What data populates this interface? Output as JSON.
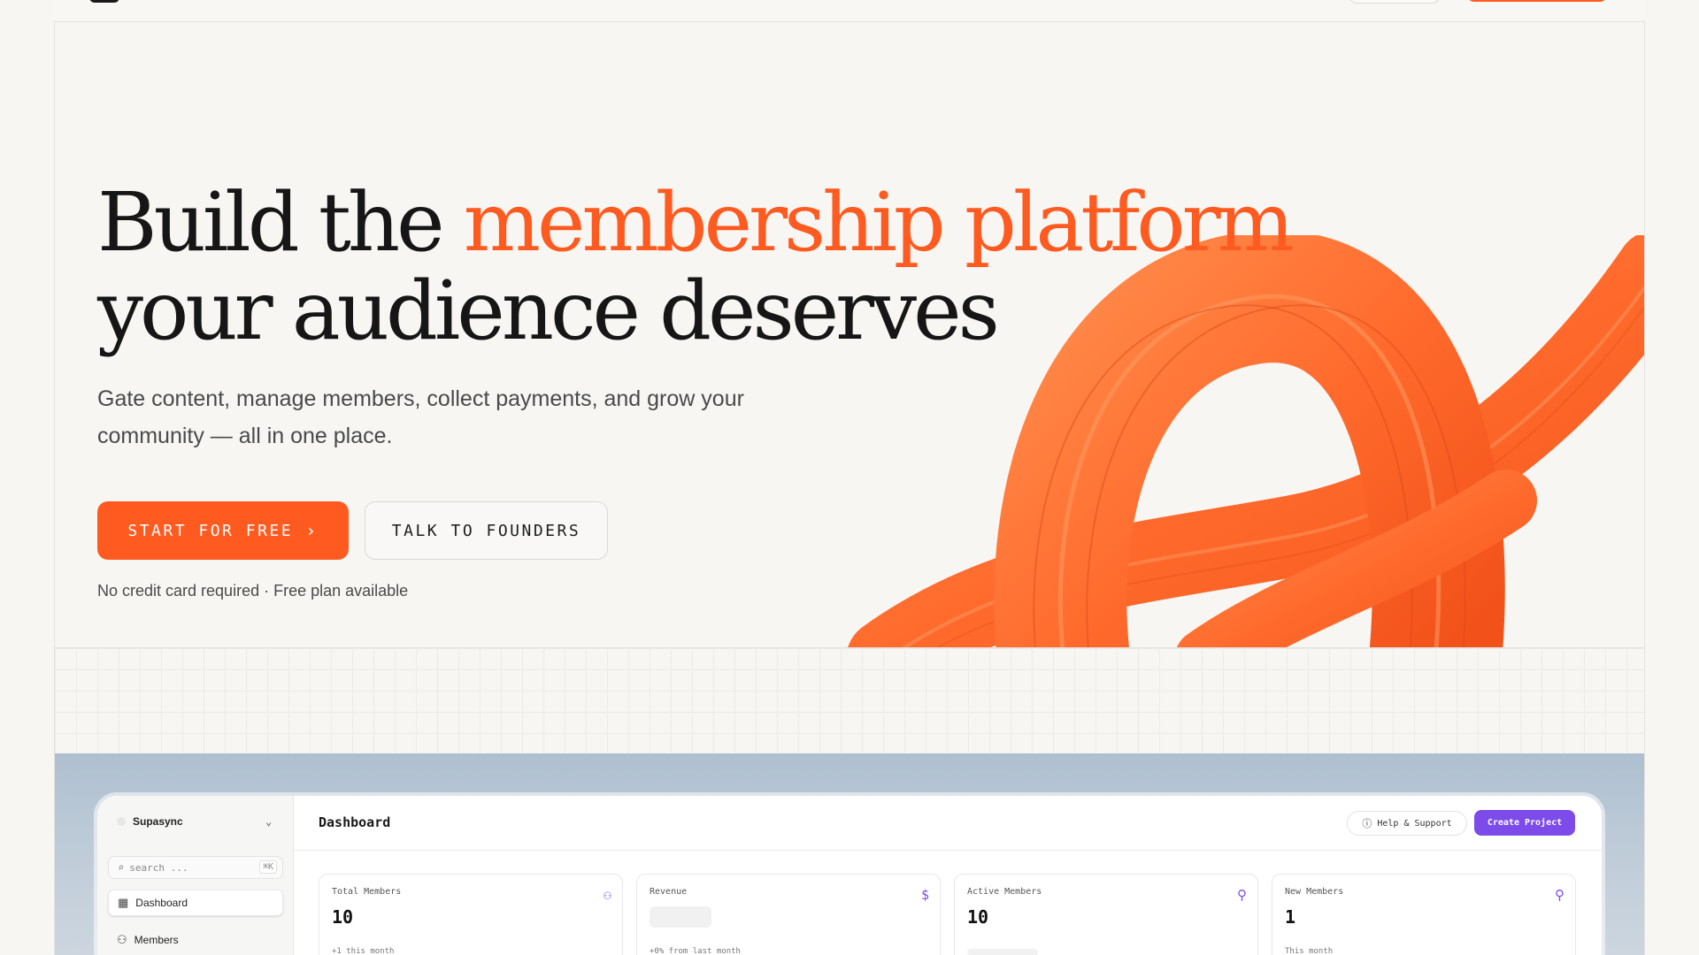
{
  "hero": {
    "headline_part1": "Build the ",
    "headline_accent": "membership platform",
    "headline_line2": "your audience deserves",
    "subheadline": "Gate content, manage members, collect payments, and grow your community — all in one place.",
    "primary_cta": "START FOR FREE",
    "secondary_cta": "TALK TO FOUNDERS",
    "note": "No credit card required · Free plan available"
  },
  "colors": {
    "accent": "#ff5a1f",
    "app_accent": "#7c4bea",
    "background": "#f7f6f3"
  },
  "app": {
    "workspace_name": "Supasync",
    "search_placeholder": "search ...",
    "search_shortcut": "⌘K",
    "sidebar": {
      "items": [
        {
          "label": "Dashboard",
          "icon": "grid-icon",
          "active": true
        },
        {
          "label": "Members",
          "icon": "users-icon",
          "active": false
        }
      ]
    },
    "header": {
      "title": "Dashboard",
      "help_label": "Help & Support",
      "create_label": "Create Project"
    },
    "stats": [
      {
        "label": "Total Members",
        "value": "10",
        "sub": "+1 this month",
        "icon": "users-icon"
      },
      {
        "label": "Revenue",
        "value": "",
        "sub": "+0% from last month",
        "icon": "dollar-icon"
      },
      {
        "label": "Active Members",
        "value": "10",
        "sub": "",
        "icon": "user-check-icon"
      },
      {
        "label": "New Members",
        "value": "1",
        "sub": "This month",
        "icon": "user-plus-icon"
      }
    ]
  }
}
